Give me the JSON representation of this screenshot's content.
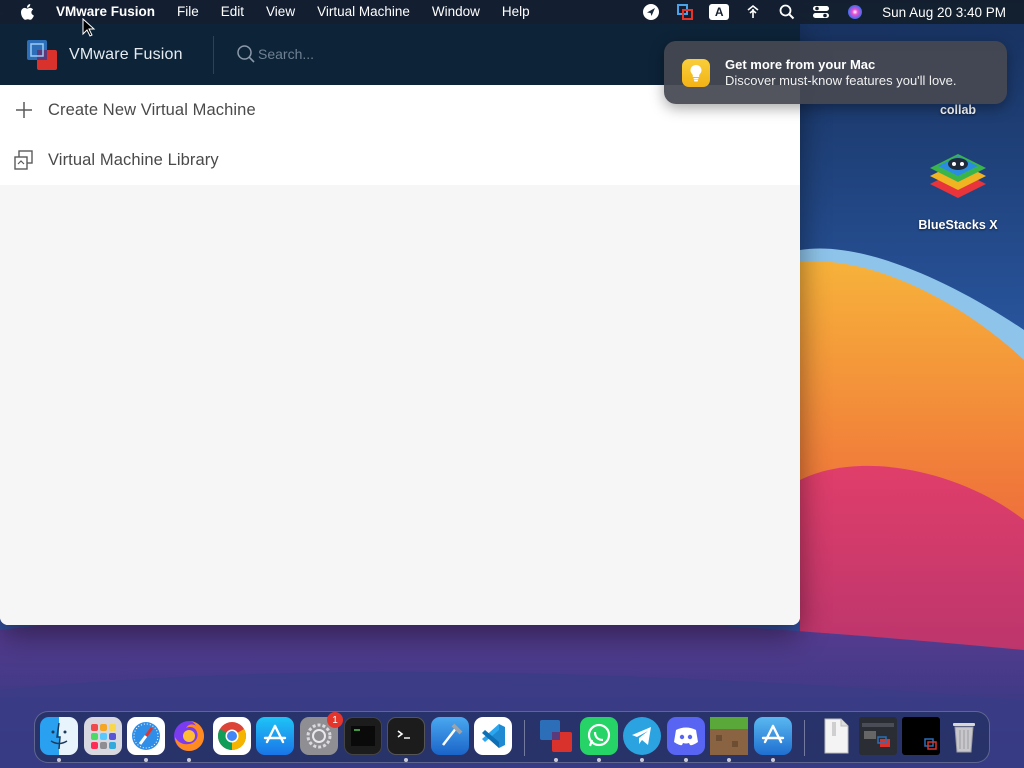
{
  "menubar": {
    "app_name": "VMware Fusion",
    "items": [
      "File",
      "Edit",
      "View",
      "Virtual Machine",
      "Window",
      "Help"
    ],
    "status_icons": [
      "navigation-icon",
      "vmware-status-icon",
      "input-source-icon",
      "wifi-icon",
      "spotlight-icon",
      "control-center-icon",
      "siri-icon"
    ],
    "input_source_label": "A",
    "clock": "Sun Aug 20  3:40 PM"
  },
  "window": {
    "title": "VMware Fusion",
    "search": {
      "placeholder": "Search..."
    },
    "rows": [
      {
        "label": "Create New Virtual Machine",
        "icon": "plus-icon"
      },
      {
        "label": "Virtual Machine Library",
        "icon": "library-icon"
      }
    ]
  },
  "notification": {
    "title": "Get more from your Mac",
    "body": "Discover must-know features you'll love.",
    "icon": "lightbulb-icon"
  },
  "desktop": {
    "icons": [
      {
        "label": "collab"
      },
      {
        "label": "BlueStacks X"
      }
    ]
  },
  "dock": {
    "items": [
      {
        "name": "finder",
        "icon": "finder-icon",
        "running": true
      },
      {
        "name": "launchpad",
        "icon": "launchpad-icon",
        "running": false
      },
      {
        "name": "safari",
        "icon": "safari-icon",
        "running": true
      },
      {
        "name": "firefox",
        "icon": "firefox-icon",
        "running": true
      },
      {
        "name": "chrome",
        "icon": "chrome-icon",
        "running": false
      },
      {
        "name": "app-store",
        "icon": "app-store-icon",
        "running": false
      },
      {
        "name": "system-settings",
        "icon": "settings-icon",
        "running": false,
        "badge": "1"
      },
      {
        "name": "terminal-exec",
        "icon": "terminal-exec-icon",
        "running": false
      },
      {
        "name": "terminal",
        "icon": "terminal-icon",
        "running": true
      },
      {
        "name": "xcode",
        "icon": "xcode-icon",
        "running": false
      },
      {
        "name": "vscode",
        "icon": "vscode-icon",
        "running": false
      },
      {
        "name": "vmware-fusion",
        "icon": "vmware-fusion-icon",
        "running": true
      },
      {
        "name": "whatsapp",
        "icon": "whatsapp-icon",
        "running": true
      },
      {
        "name": "telegram",
        "icon": "telegram-icon",
        "running": true
      },
      {
        "name": "discord",
        "icon": "discord-icon",
        "running": true
      },
      {
        "name": "minecraft",
        "icon": "minecraft-icon",
        "running": true
      },
      {
        "name": "app-store-2",
        "icon": "app-store-icon",
        "running": true
      },
      {
        "name": "document",
        "icon": "document-icon",
        "running": false
      },
      {
        "name": "screenshot-thumb",
        "icon": "window-thumbnail-icon",
        "running": false
      },
      {
        "name": "vmware-thumb",
        "icon": "window-thumbnail-icon",
        "running": false
      },
      {
        "name": "trash",
        "icon": "trash-icon",
        "running": false
      }
    ]
  },
  "colors": {
    "menubar_bg": "#141e2d",
    "titlebar_bg": "#0d2338",
    "notification_bg": "#464852",
    "accent_red": "#e5352b"
  }
}
